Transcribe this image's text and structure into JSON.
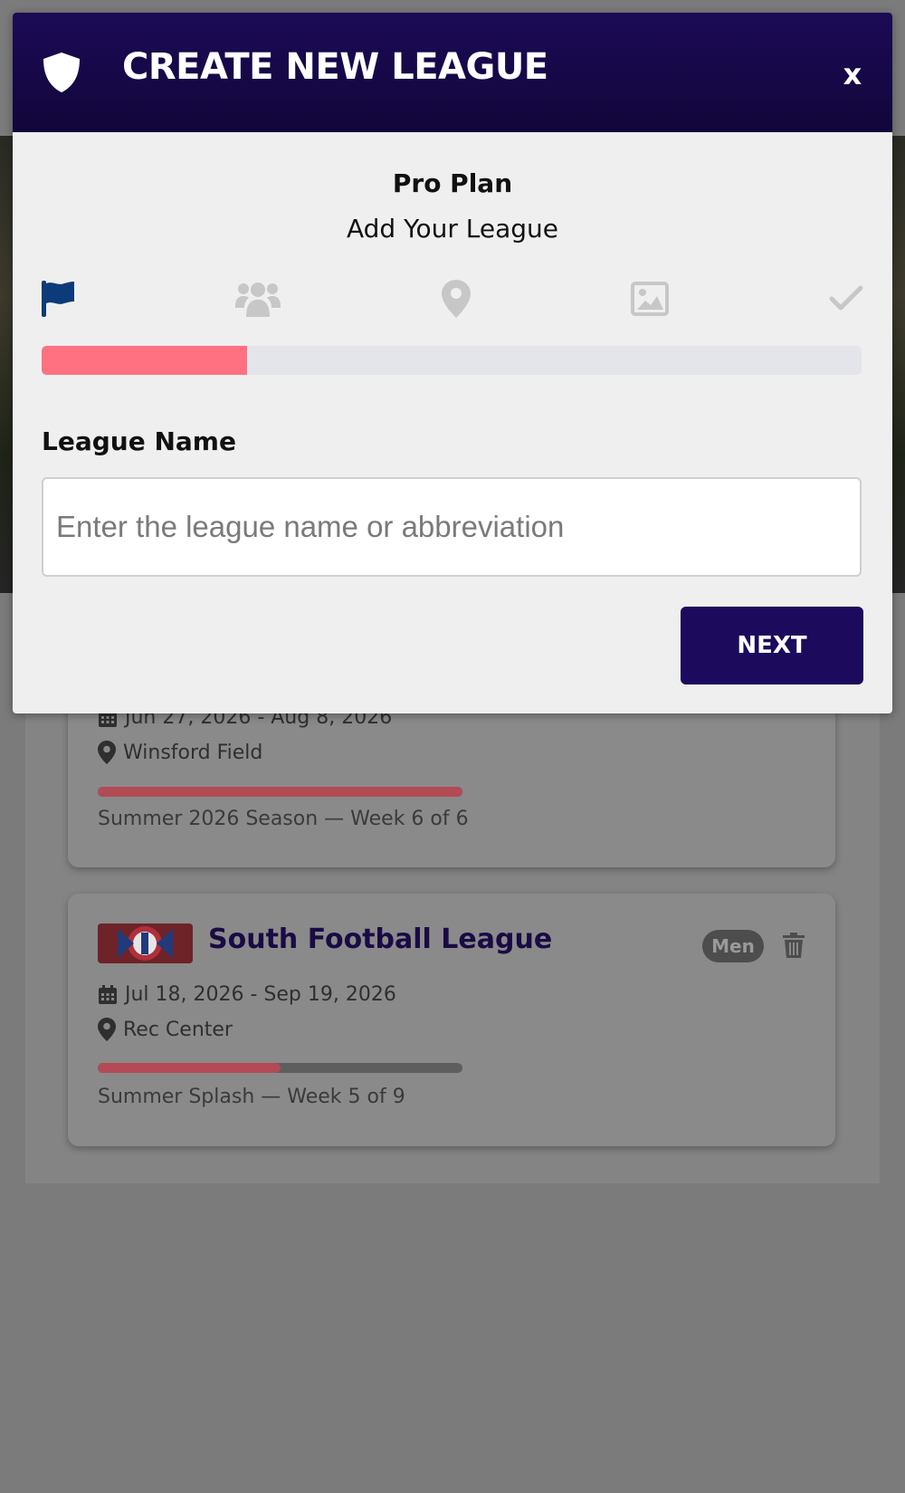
{
  "modal": {
    "title": "CREATE NEW LEAGUE",
    "close_label": "x",
    "plan_title": "Pro Plan",
    "plan_subtitle": "Add Your League",
    "steps": [
      {
        "icon": "flag-icon",
        "active": true
      },
      {
        "icon": "users-icon",
        "active": false
      },
      {
        "icon": "map-marker-icon",
        "active": false
      },
      {
        "icon": "image-icon",
        "active": false
      },
      {
        "icon": "checkmark-icon",
        "active": false
      }
    ],
    "progress": 0.25,
    "field_label": "League Name",
    "field_value": "",
    "field_placeholder": "Enter the league name or abbreviation",
    "next_label": "NEXT",
    "colors": {
      "header": "#1c0a56",
      "accent": "#ff7180",
      "active_step": "#0d3a7a",
      "button": "#1c0a5c"
    }
  },
  "background": {
    "leagues": [
      {
        "dates": "Jun 27, 2026 - Aug 8, 2026",
        "location": "Winsford Field",
        "progress": 1.0,
        "season": "Summer 2026 Season — Week 6 of 6"
      },
      {
        "name": "South Football League",
        "badge": "Men",
        "dates": "Jul 18, 2026 - Sep 19, 2026",
        "location": "Rec Center",
        "progress": 0.5,
        "season": "Summer Splash — Week 5 of 9"
      }
    ]
  }
}
